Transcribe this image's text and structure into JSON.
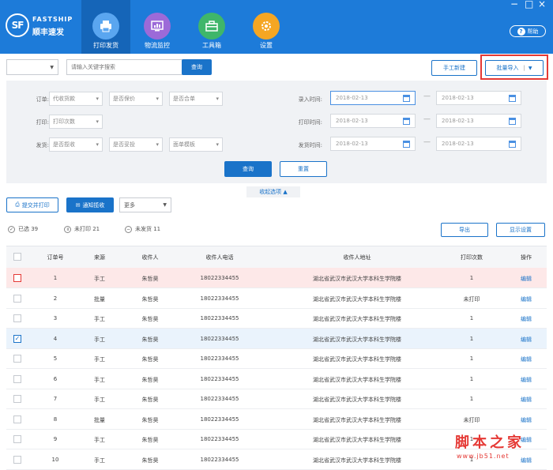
{
  "brand": {
    "name_en": "FASTSHIP",
    "name_cn": "顺丰速发",
    "logo_text": "SF"
  },
  "nav": [
    {
      "label": "打印发货",
      "icon": "printer-icon",
      "color": "#5aa6f0",
      "active": true
    },
    {
      "label": "物流监控",
      "icon": "monitor-icon",
      "color": "#9c6ad8",
      "active": false
    },
    {
      "label": "工具箱",
      "icon": "toolbox-icon",
      "color": "#3fb66a",
      "active": false
    },
    {
      "label": "设置",
      "icon": "gear-icon",
      "color": "#f5a623",
      "active": false
    }
  ],
  "window": {
    "minimize": "−",
    "maximize": "□",
    "close": "×"
  },
  "help_label": "帮助",
  "search": {
    "placeholder": "请输入关键字搜索",
    "button": "查询",
    "type_value": ""
  },
  "toolbar_right": {
    "manual_new": "手工新建",
    "batch_import": "批量导入"
  },
  "filters": {
    "row1": {
      "label": "订单:",
      "selects": [
        "代收货款",
        "是否保价",
        "是否合单"
      ],
      "time_label": "录入时间:",
      "date_from": "2018-02-13",
      "date_to": "2018-02-13"
    },
    "row2": {
      "label": "打印:",
      "selects": [
        "打印次数"
      ],
      "time_label": "打印时间:",
      "date_from": "2018-02-13",
      "date_to": "2018-02-13"
    },
    "row3": {
      "label": "发货:",
      "selects": [
        "是否揽收",
        "是否妥投",
        "面单模板"
      ],
      "time_label": "发货时间:",
      "date_from": "2018-02-13",
      "date_to": "2018-02-13"
    },
    "query": "查询",
    "reset": "重置",
    "collapse": "收起选项 ▲"
  },
  "actions": {
    "submit_print": "提交并打印",
    "notify_pickup": "通知揽收",
    "more": "更多"
  },
  "stats": {
    "selected": "已选 39",
    "unprinted": "未打印 21",
    "unshipped": "未发货 11"
  },
  "export_label": "导出",
  "display_settings": "显示设置",
  "table": {
    "headers": [
      "订单号",
      "来源",
      "收件人",
      "收件人电话",
      "收件人地址",
      "打印次数",
      "操作"
    ],
    "rows": [
      {
        "no": "1",
        "source": "手工",
        "name": "朱哲昊",
        "phone": "18022334455",
        "address": "湖北省武汉市武汉大学本科生学院楼",
        "prints": "1",
        "op": "编辑",
        "state": "error"
      },
      {
        "no": "2",
        "source": "批量",
        "name": "朱哲昊",
        "phone": "18022334455",
        "address": "湖北省武汉市武汉大学本科生学院楼",
        "prints": "未打印",
        "op": "编辑",
        "state": ""
      },
      {
        "no": "3",
        "source": "手工",
        "name": "朱哲昊",
        "phone": "18022334455",
        "address": "湖北省武汉市武汉大学本科生学院楼",
        "prints": "1",
        "op": "编辑",
        "state": ""
      },
      {
        "no": "4",
        "source": "手工",
        "name": "朱哲昊",
        "phone": "18022334455",
        "address": "湖北省武汉市武汉大学本科生学院楼",
        "prints": "1",
        "op": "编辑",
        "state": "checked"
      },
      {
        "no": "5",
        "source": "手工",
        "name": "朱哲昊",
        "phone": "18022334455",
        "address": "湖北省武汉市武汉大学本科生学院楼",
        "prints": "1",
        "op": "编辑",
        "state": ""
      },
      {
        "no": "6",
        "source": "手工",
        "name": "朱哲昊",
        "phone": "18022334455",
        "address": "湖北省武汉市武汉大学本科生学院楼",
        "prints": "1",
        "op": "编辑",
        "state": ""
      },
      {
        "no": "7",
        "source": "手工",
        "name": "朱哲昊",
        "phone": "18022334455",
        "address": "湖北省武汉市武汉大学本科生学院楼",
        "prints": "1",
        "op": "编辑",
        "state": ""
      },
      {
        "no": "8",
        "source": "批量",
        "name": "朱哲昊",
        "phone": "18022334455",
        "address": "湖北省武汉市武汉大学本科生学院楼",
        "prints": "未打印",
        "op": "编辑",
        "state": ""
      },
      {
        "no": "9",
        "source": "手工",
        "name": "朱哲昊",
        "phone": "18022334455",
        "address": "湖北省武汉市武汉大学本科生学院楼",
        "prints": "1",
        "op": "编辑",
        "state": ""
      },
      {
        "no": "10",
        "source": "手工",
        "name": "朱哲昊",
        "phone": "18022334455",
        "address": "湖北省武汉市武汉大学本科生学院楼",
        "prints": "1",
        "op": "编辑",
        "state": ""
      }
    ]
  },
  "watermark": {
    "main": "脚本之家",
    "url": "www.jb51.net"
  }
}
